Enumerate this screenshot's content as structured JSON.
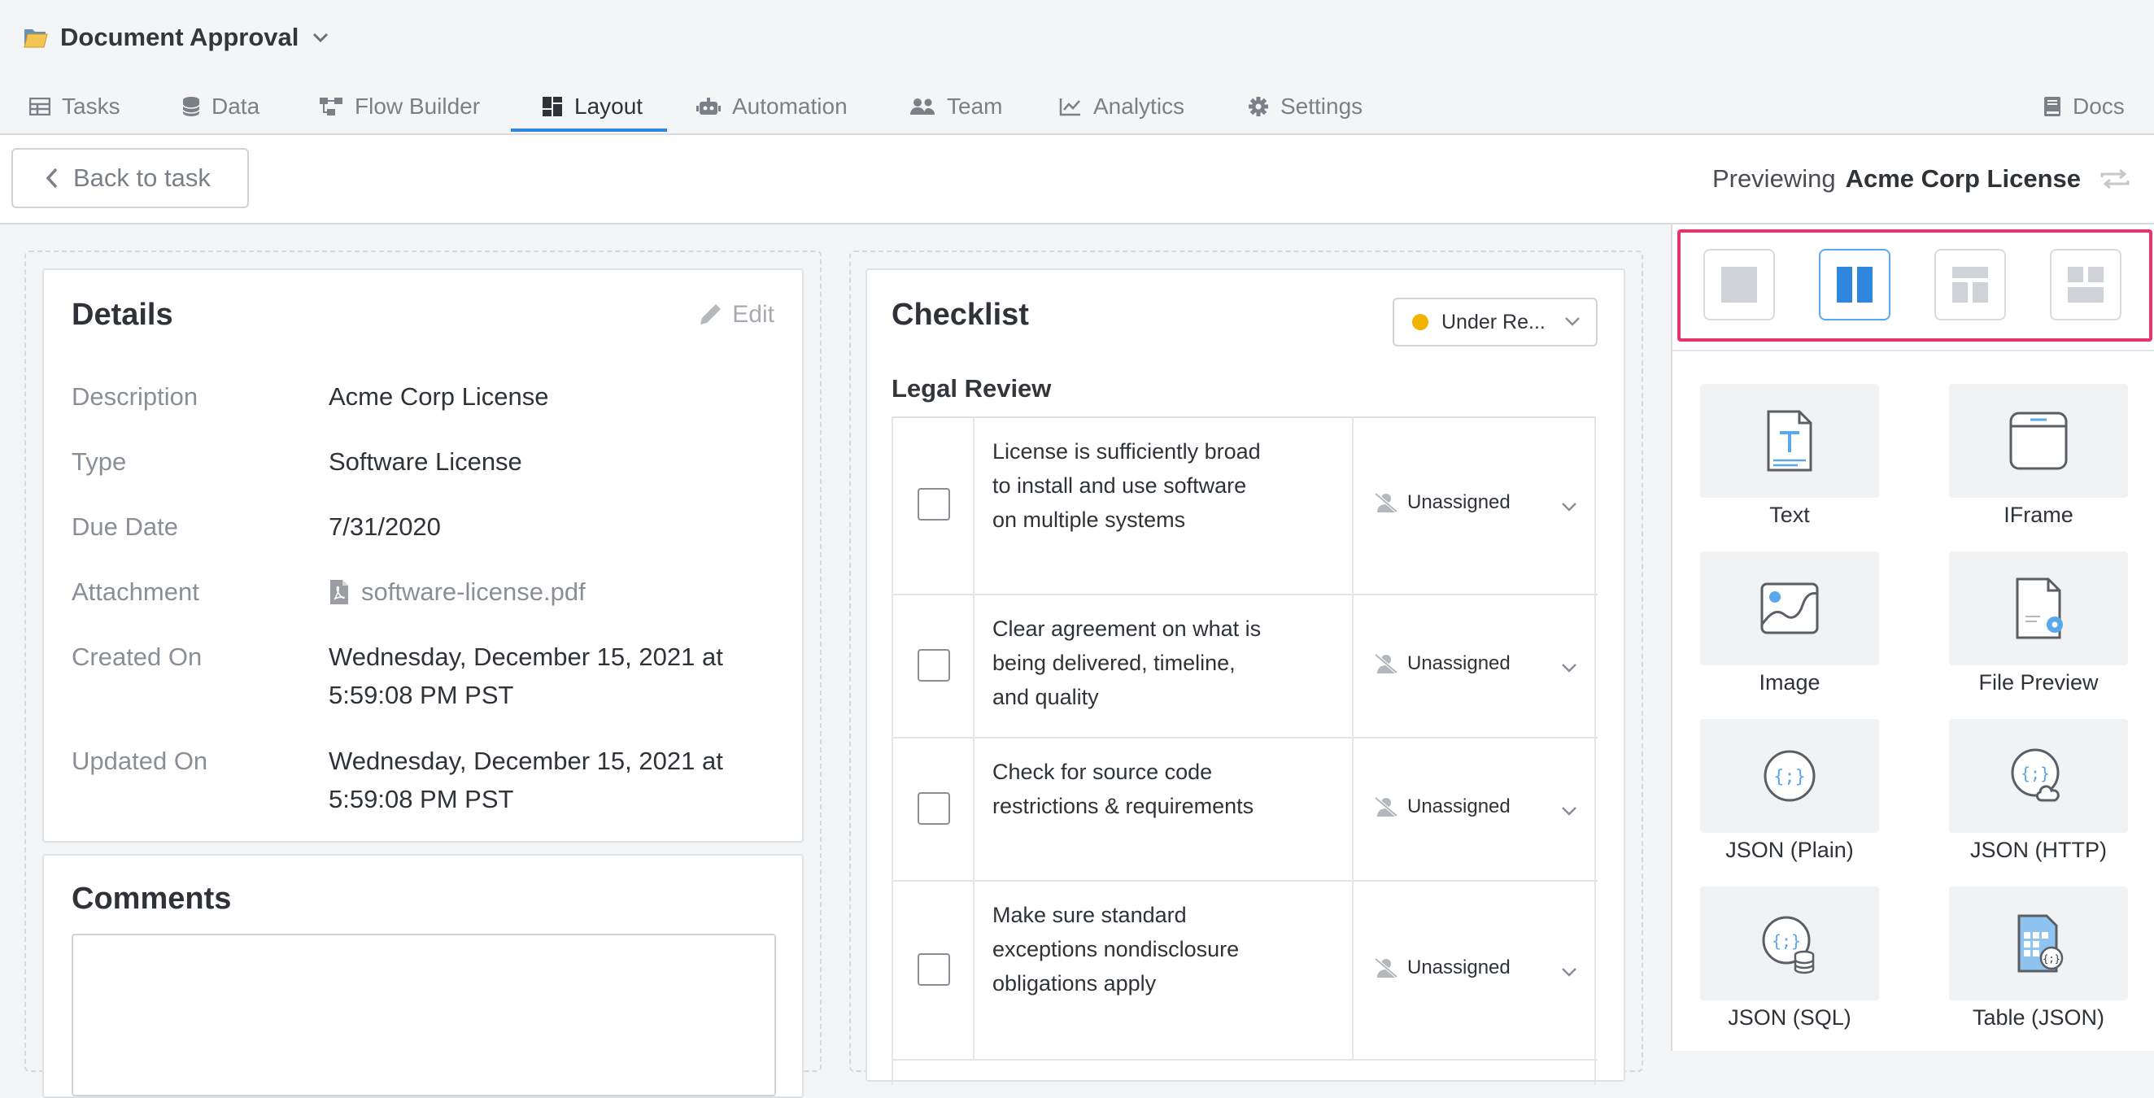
{
  "app": {
    "title": "Document Approval"
  },
  "nav": {
    "tabs": [
      {
        "label": "Tasks",
        "icon": "table-icon"
      },
      {
        "label": "Data",
        "icon": "database-icon"
      },
      {
        "label": "Flow Builder",
        "icon": "flow-icon"
      },
      {
        "label": "Layout",
        "icon": "layout-icon",
        "active": true
      },
      {
        "label": "Automation",
        "icon": "robot-icon"
      },
      {
        "label": "Team",
        "icon": "users-icon"
      },
      {
        "label": "Analytics",
        "icon": "chart-line-icon"
      },
      {
        "label": "Settings",
        "icon": "gear-icon"
      }
    ],
    "docs_label": "Docs"
  },
  "toolbar": {
    "back_label": "Back to task",
    "preview_prefix": "Previewing",
    "preview_name": "Acme Corp License"
  },
  "details": {
    "title": "Details",
    "edit_label": "Edit",
    "rows": [
      {
        "label": "Description",
        "value": "Acme Corp License"
      },
      {
        "label": "Type",
        "value": "Software License"
      },
      {
        "label": "Due Date",
        "value": "7/31/2020"
      },
      {
        "label": "Attachment",
        "value": "software-license.pdf"
      },
      {
        "label": "Created On",
        "value": "Wednesday, December 15, 2021 at 5:59:08 PM PST"
      },
      {
        "label": "Updated On",
        "value": "Wednesday, December 15, 2021 at 5:59:08 PM PST"
      }
    ]
  },
  "comments": {
    "title": "Comments"
  },
  "checklist": {
    "title": "Checklist",
    "status": "Under Re...",
    "status_color": "#f0b400",
    "section": "Legal Review",
    "items": [
      {
        "text": "License is sufficiently broad to install and use software on multiple systems",
        "assignee": "Unassigned"
      },
      {
        "text": "Clear agreement on what is being delivered, timeline, and quality",
        "assignee": "Unassigned"
      },
      {
        "text": "Check for source code restrictions & requirements",
        "assignee": "Unassigned"
      },
      {
        "text": "Make sure standard exceptions nondisclosure obligations apply",
        "assignee": "Unassigned"
      }
    ]
  },
  "layout_options": [
    "single-column",
    "two-columns",
    "header-two-columns",
    "grid-layout"
  ],
  "widgets": [
    {
      "label": "Text",
      "icon": "text-doc-icon"
    },
    {
      "label": "IFrame",
      "icon": "browser-window-icon"
    },
    {
      "label": "Image",
      "icon": "image-icon"
    },
    {
      "label": "File Preview",
      "icon": "file-preview-icon"
    },
    {
      "label": "JSON (Plain)",
      "icon": "json-icon"
    },
    {
      "label": "JSON (HTTP)",
      "icon": "json-cloud-icon"
    },
    {
      "label": "JSON (SQL)",
      "icon": "json-database-icon"
    },
    {
      "label": "Table (JSON)",
      "icon": "table-json-icon"
    }
  ],
  "colors": {
    "accent": "#2e86de",
    "highlight_border": "#e8336d",
    "status_dot": "#f0b400"
  }
}
